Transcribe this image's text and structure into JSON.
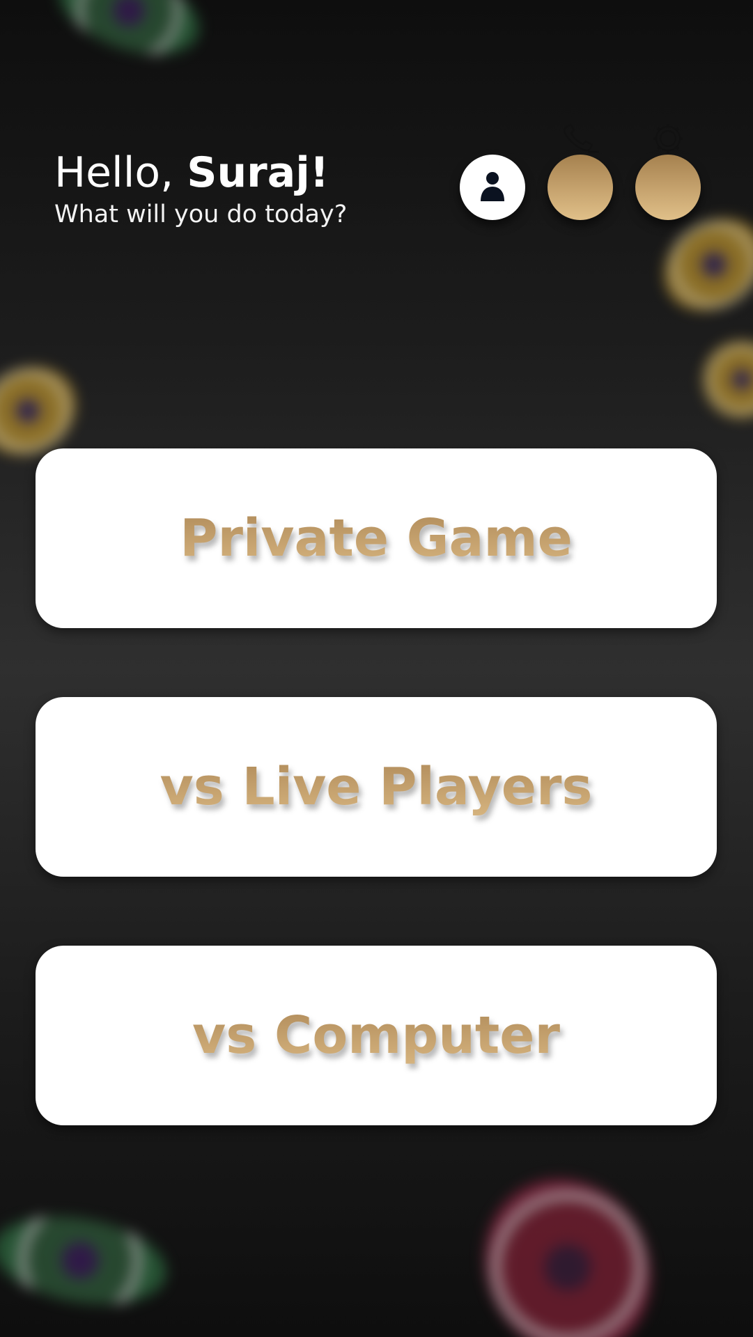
{
  "greeting": {
    "hello_prefix": "Hello, ",
    "user_name": "Suraj!",
    "subtitle": "What will you do today?"
  },
  "header_buttons": {
    "profile_icon": "person-icon",
    "support_icon": "phone-icon",
    "settings_icon": "gear-icon"
  },
  "modes": [
    {
      "label": "Private Game"
    },
    {
      "label": "vs Live Players"
    },
    {
      "label": "vs Computer"
    }
  ],
  "colors": {
    "accent_gold": "#c7a470",
    "card_background": "#ffffff",
    "profile_icon": "#0b1220"
  }
}
